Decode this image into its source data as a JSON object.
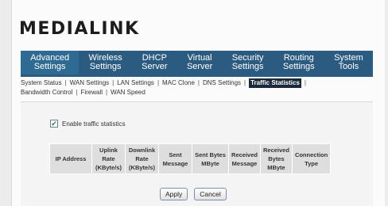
{
  "brand": {
    "logo": "MEDIALINK"
  },
  "nav": [
    {
      "line1": "Advanced",
      "line2": "Settings"
    },
    {
      "line1": "Wireless",
      "line2": "Settings"
    },
    {
      "line1": "DHCP",
      "line2": "Server"
    },
    {
      "line1": "Virtual",
      "line2": "Server"
    },
    {
      "line1": "Security",
      "line2": "Settings"
    },
    {
      "line1": "Routing",
      "line2": "Settings"
    },
    {
      "line1": "System",
      "line2": "Tools"
    }
  ],
  "subnav": {
    "row1": [
      "System Status",
      "WAN Settings",
      "LAN Settings",
      "MAC Clone",
      "DNS Settings",
      "Traffic Statistics"
    ],
    "row2": [
      "Bandwidth Control",
      "Firewall",
      "WAN Speed"
    ],
    "active": "Traffic Statistics"
  },
  "traffic": {
    "enable_label": "Enable traffic statistics",
    "enabled": true,
    "columns": [
      [
        "IP Address"
      ],
      [
        "Uplink",
        "Rate",
        "(KByte/s)"
      ],
      [
        "Downlink",
        "Rate",
        "(KByte/s)"
      ],
      [
        "Sent",
        "Message"
      ],
      [
        "Sent Bytes",
        "MByte"
      ],
      [
        "Received",
        "Message"
      ],
      [
        "Received",
        "Bytes",
        "MByte"
      ],
      [
        "Connection",
        "Type"
      ]
    ]
  },
  "buttons": {
    "apply": "Apply",
    "cancel": "Cancel"
  },
  "colors": {
    "nav_bg": "#2c5b82",
    "active_subtab_bg": "#1b2a3a"
  }
}
